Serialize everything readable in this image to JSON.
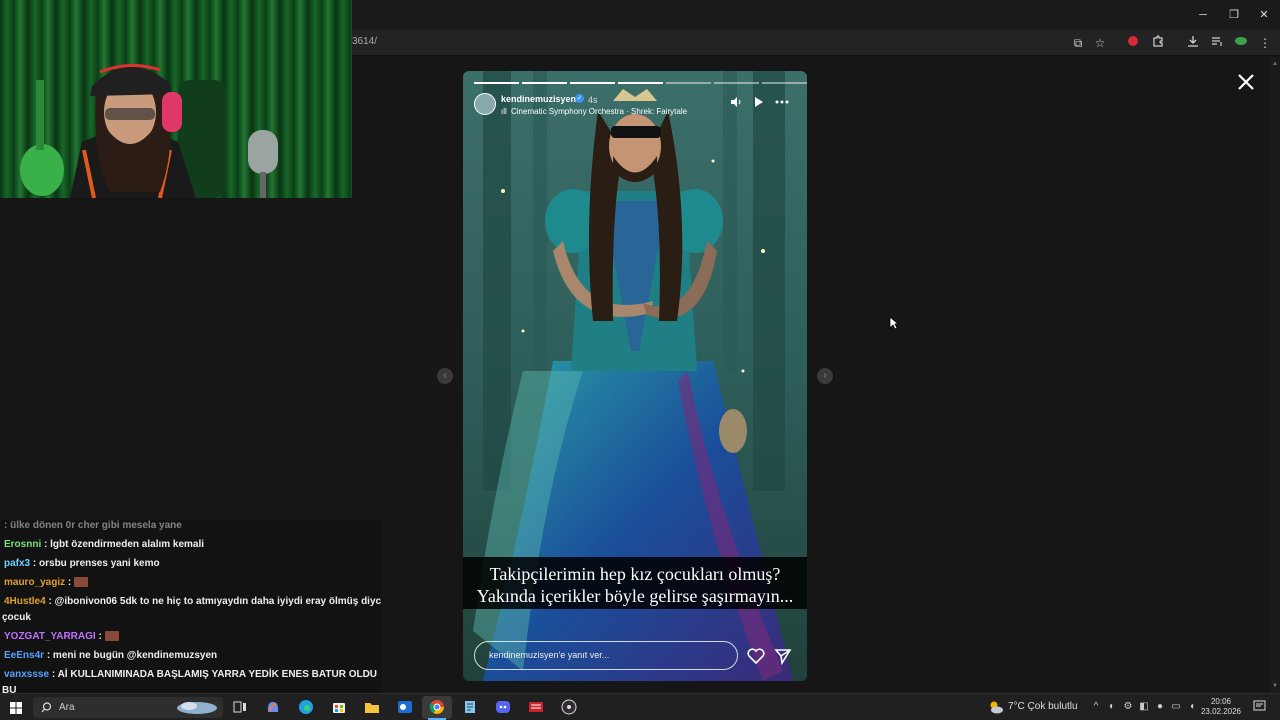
{
  "browser": {
    "url_fragment": "3614/",
    "window_controls": [
      "─",
      "❐",
      "✕"
    ]
  },
  "story": {
    "username": "kendinemuzisyen",
    "time": "4s",
    "music_bars": "ıll",
    "music": "Cinematic Symphony Orchestra · Shrek: Fairytale",
    "caption_line1": "Takipçilerimin hep kız çocukları olmuş?",
    "caption_line2": "Yakında içerikler böyle gelirse şaşırmayın...",
    "reply_placeholder": "kendinemuzisyen'e yanıt ver...",
    "progress_done": 4,
    "progress_total": 7
  },
  "chat": {
    "messages": [
      {
        "user": "",
        "text": ": ülke dönen 0r cher gibi mesela yane",
        "user_color": "#e05050"
      },
      {
        "user": "Erosnni",
        "text": ": lgbt özendirmeden alalım kemali",
        "user_color": "#7fdf7f"
      },
      {
        "user": "pafx3",
        "text": ": orsbu prenses yani kemo",
        "user_color": "#6fd0ff"
      },
      {
        "user": "mauro_yagiz",
        "text": ":",
        "user_color": "#e0a030"
      },
      {
        "user": "4Hustle4",
        "text": ": @ibonivon06 5dk to ne hiç to atmıyaydın daha iyiydi eray ölmüş diyc",
        "user_color": "#e0a030"
      },
      {
        "user": "",
        "text": "çocuk",
        "user_color": "#ffffff"
      },
      {
        "user": "YOZGAT_YARRAGI",
        "text": ":",
        "user_color": "#c070ff"
      },
      {
        "user": "EeEns4r",
        "text": ": meni ne bugün @kendinemuzsyen",
        "user_color": "#5aa0ff"
      },
      {
        "user": "vanxssse",
        "text": ": Aİ KULLANIMINADA BAŞLAMIŞ YARRA YEDİK ENES BATUR OLDU",
        "user_color": "#5aa0ff"
      },
      {
        "user": "",
        "text": "BU",
        "user_color": "#ffffff"
      }
    ]
  },
  "taskbar": {
    "search_text": "Ara",
    "weather": "7°C  Çok bulutlu",
    "time": "20:06",
    "date": "23.02.2026"
  }
}
